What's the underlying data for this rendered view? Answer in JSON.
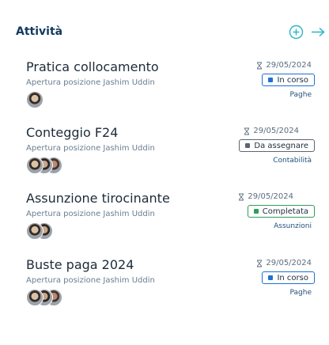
{
  "header": {
    "title": "Attività",
    "accent_color": "#2bb3c9"
  },
  "items": [
    {
      "title": "Pratica collocamento",
      "subtitle": "Apertura posizione Jashim Uddin",
      "date": "29/05/2024",
      "status": "In corso",
      "status_color": "#1f6fd4",
      "category": "Paghe",
      "avatars": 1
    },
    {
      "title": "Conteggio F24",
      "subtitle": "Apertura posizione Jashim Uddin",
      "date": "29/05/2024",
      "status": "Da assegnare",
      "status_color": "#5c6670",
      "category": "Contabilità",
      "avatars": 3
    },
    {
      "title": "Assunzione tirocinante",
      "subtitle": "Apertura posizione Jashim Uddin",
      "date": "29/05/2024",
      "status": "Completata",
      "status_color": "#2f9d5b",
      "category": "Assunzioni",
      "avatars": 2
    },
    {
      "title": "Buste paga 2024",
      "subtitle": "Apertura posizione Jashim Uddin",
      "date": "29/05/2024",
      "status": "In corso",
      "status_color": "#1f6fd4",
      "category": "Paghe",
      "avatars": 3
    }
  ]
}
